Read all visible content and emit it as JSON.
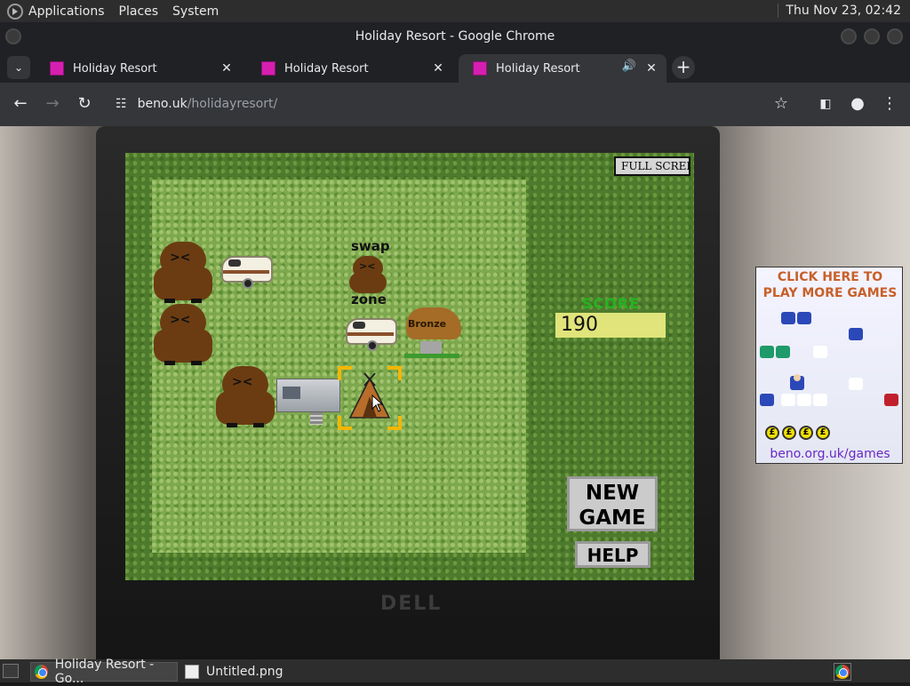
{
  "system_bar": {
    "menus": [
      "Applications",
      "Places",
      "System"
    ],
    "clock": "Thu Nov 23, 02:42"
  },
  "window": {
    "title": "Holiday Resort - Google Chrome"
  },
  "tabs": [
    {
      "title": "Holiday Resort",
      "active": false
    },
    {
      "title": "Holiday Resort",
      "active": false
    },
    {
      "title": "Holiday Resort",
      "active": true,
      "audio": true
    }
  ],
  "toolbar": {
    "url_host": "beno.uk",
    "url_path": "/holidayresort/"
  },
  "game": {
    "fullscreen_label": "FULL SCREEN",
    "swap_label_top": "swap",
    "swap_label_bottom": "zone",
    "trophy_label": "Bronze",
    "score_label": "SCORE",
    "score_value": "190",
    "new_game_line1": "NEW",
    "new_game_line2": "GAME",
    "help_label": "HELP"
  },
  "ad": {
    "headline_line1": "CLICK HERE TO",
    "headline_line2": "PLAY MORE GAMES",
    "coin_symbol": "£",
    "link": "beno.org.uk/games"
  },
  "taskbar": {
    "items": [
      {
        "label": "Holiday Resort - Go...",
        "icon": "chrome-icon",
        "active": true
      },
      {
        "label": "Untitled.png",
        "icon": "image-file-icon",
        "active": false
      }
    ]
  },
  "colors": {
    "accent_tab_favicon": "#d61fb0",
    "score_label_green": "#24b320",
    "selector_yellow": "#f2b705"
  }
}
